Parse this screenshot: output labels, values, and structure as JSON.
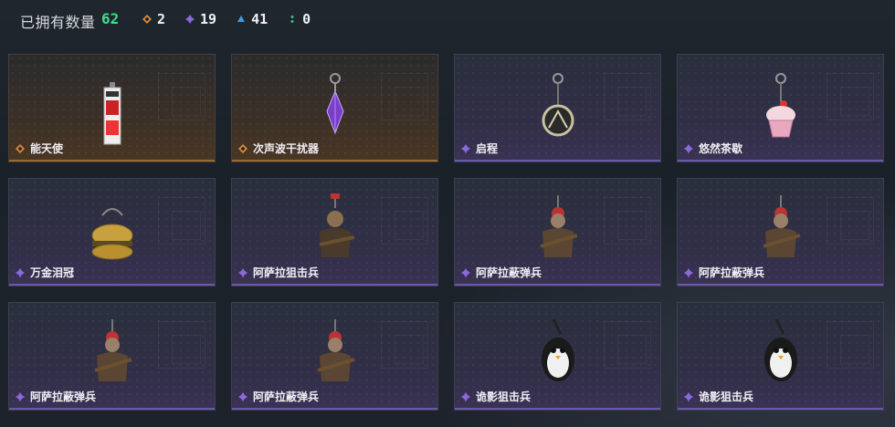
{
  "header": {
    "owned_label": "已拥有数量",
    "owned_count": "62",
    "counts": [
      {
        "icon": "orange-rarity-icon",
        "value": "2",
        "color": "#d98a3a"
      },
      {
        "icon": "purple-rarity-icon",
        "value": "19",
        "color": "#8a6ad8"
      },
      {
        "icon": "blue-rarity-icon",
        "value": "41",
        "color": "#4a9ad8"
      },
      {
        "icon": "green-rarity-icon",
        "value": "0",
        "color": "#3ec08a"
      }
    ]
  },
  "colors": {
    "owned_count": "#3ee08a",
    "orange_rarity": "#d98a3a",
    "purple_rarity": "#8a6ad8"
  },
  "items": [
    {
      "name": "能天使",
      "rarity": "orange",
      "charm": "card-charm-icon"
    },
    {
      "name": "次声波干扰器",
      "rarity": "orange",
      "charm": "crystal-charm-icon"
    },
    {
      "name": "启程",
      "rarity": "purple",
      "charm": "medallion-charm-icon"
    },
    {
      "name": "悠然茶歇",
      "rarity": "purple",
      "charm": "cupcake-charm-icon"
    },
    {
      "name": "万金泪冠",
      "rarity": "purple",
      "charm": "burger-charm-icon"
    },
    {
      "name": "阿萨拉狙击兵",
      "rarity": "purple",
      "charm": "soldier-charm-icon"
    },
    {
      "name": "阿萨拉蔽弹兵",
      "rarity": "purple",
      "charm": "soldier-charm-icon"
    },
    {
      "name": "阿萨拉蔽弹兵",
      "rarity": "purple",
      "charm": "soldier-charm-icon"
    },
    {
      "name": "阿萨拉蔽弹兵",
      "rarity": "purple",
      "charm": "soldier-charm-icon"
    },
    {
      "name": "阿萨拉蔽弹兵",
      "rarity": "purple",
      "charm": "soldier-charm-icon"
    },
    {
      "name": "诡影狙击兵",
      "rarity": "purple",
      "charm": "penguin-charm-icon"
    },
    {
      "name": "诡影狙击兵",
      "rarity": "purple",
      "charm": "penguin-charm-icon"
    }
  ]
}
